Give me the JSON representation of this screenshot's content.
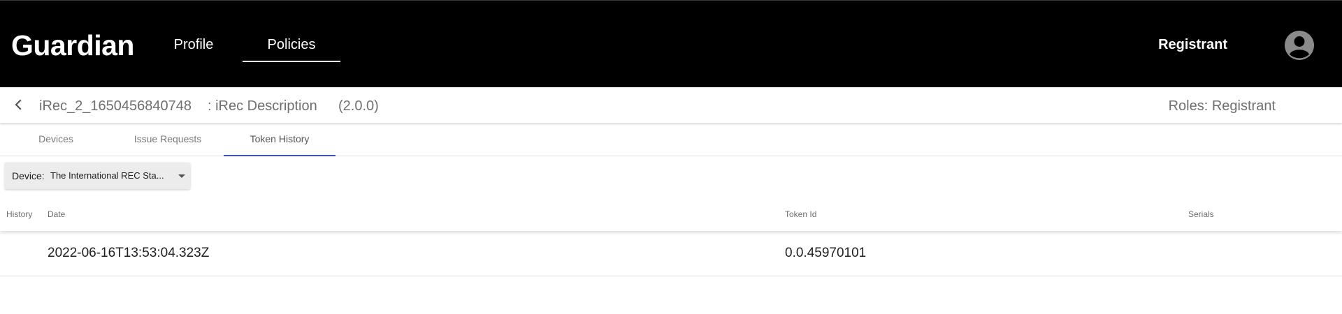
{
  "header": {
    "logo": "Guardian",
    "nav": [
      {
        "label": "Profile",
        "active": false
      },
      {
        "label": "Policies",
        "active": true
      }
    ],
    "user": {
      "name": "Registrant",
      "avatar_icon": "account-circle-icon"
    },
    "background": "#000000"
  },
  "policy_bar": {
    "back_icon": "chevron-left-icon",
    "name": "iRec_2_1650456840748",
    "description": ": iRec Description",
    "version": "(2.0.0)",
    "roles": "Roles: Registrant"
  },
  "tabs": [
    {
      "label": "Devices",
      "active": false
    },
    {
      "label": "Issue Requests",
      "active": false
    },
    {
      "label": "Token History",
      "active": true
    }
  ],
  "accent_color": "#3f51b5",
  "device_filter": {
    "label": "Device:",
    "value": "The International REC Sta...",
    "dropdown_icon": "caret-down-icon"
  },
  "table": {
    "columns": [
      "History",
      "Date",
      "Token Id",
      "Serials"
    ],
    "rows": [
      {
        "history": "",
        "date": "2022-06-16T13:53:04.323Z",
        "token_id": "0.0.45970101",
        "serials": ""
      }
    ]
  }
}
